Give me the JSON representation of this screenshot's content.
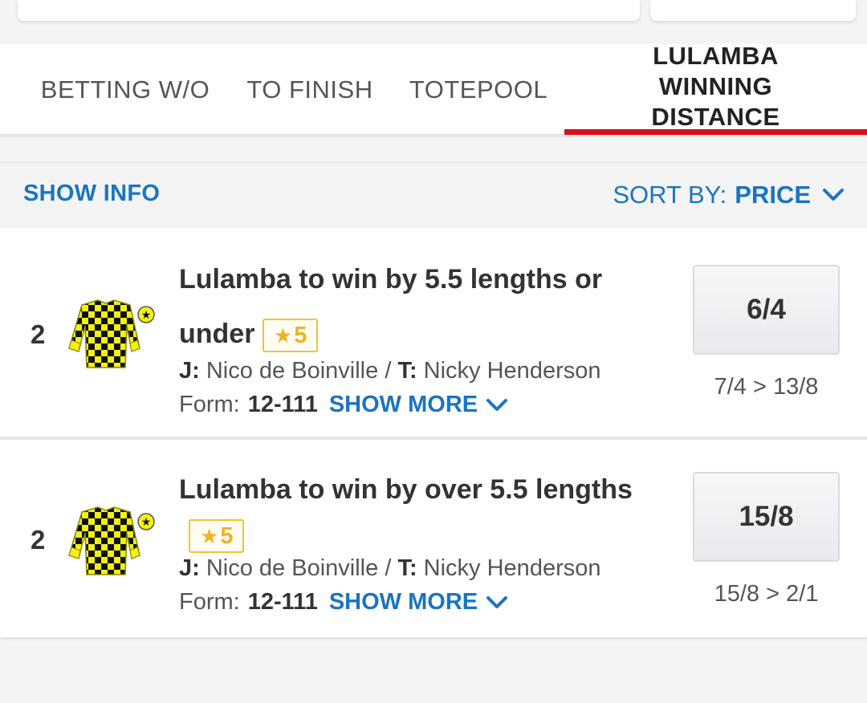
{
  "tabs": [
    {
      "label": "BETTING W/O"
    },
    {
      "label": "TO FINISH"
    },
    {
      "label": "TOTEPOOL"
    },
    {
      "label": "LULAMBA WINNING DISTANCE"
    }
  ],
  "toolbar": {
    "show_info": "SHOW INFO",
    "sort_prefix": "SORT BY:",
    "sort_value": "PRICE"
  },
  "runners": [
    {
      "number": "2",
      "title": "Lulamba to win by 5.5 lengths or under",
      "rating": "5",
      "jockey_prefix": "J:",
      "jockey": "Nico de Boinville",
      "separator": "/",
      "trainer_prefix": "T:",
      "trainer": "Nicky Henderson",
      "form_label": "Form:",
      "form": "12-111",
      "show_more": "SHOW MORE",
      "price": "6/4",
      "price_movement": "7/4 > 13/8"
    },
    {
      "number": "2",
      "title": "Lulamba to win by over 5.5 lengths",
      "rating": "5",
      "jockey_prefix": "J:",
      "jockey": "Nico de Boinville",
      "separator": "/",
      "trainer_prefix": "T:",
      "trainer": "Nicky Henderson",
      "form_label": "Form:",
      "form": "12-111",
      "show_more": "SHOW MORE",
      "price": "15/8",
      "price_movement": "15/8 > 2/1"
    }
  ],
  "colors": {
    "accent_blue": "#1a74c2",
    "active_tab_red": "#d6111a",
    "star_gold": "#f0b323",
    "silk_yellow": "#f5f010",
    "silk_black": "#111111"
  },
  "icons": {
    "sort_chevron": "chevron-down-icon",
    "show_more_chevron": "chevron-down-icon",
    "star": "star-icon",
    "silks": "jockey-silks-icon"
  }
}
